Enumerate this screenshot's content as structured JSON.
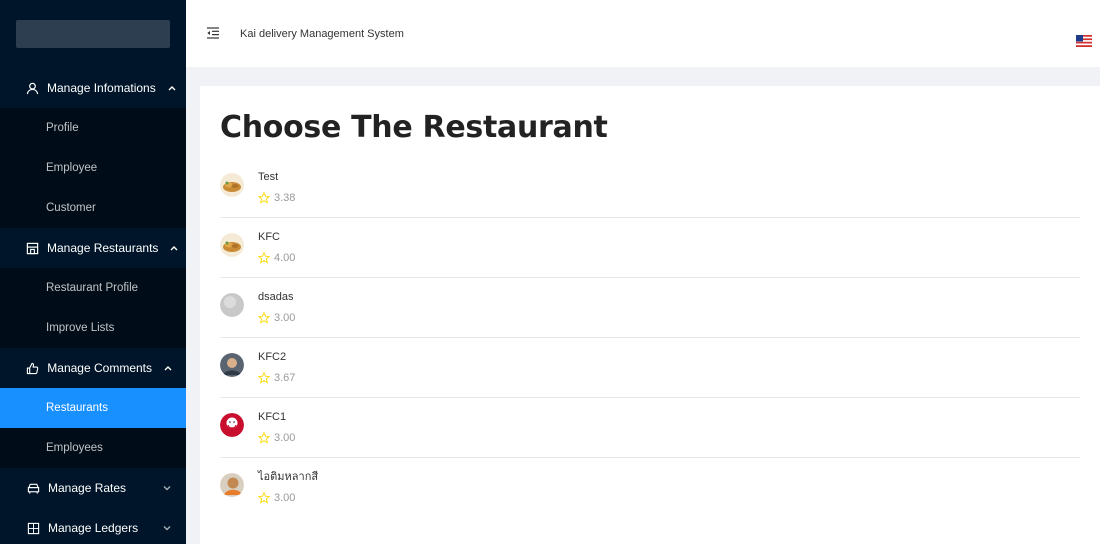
{
  "header": {
    "title": "Kai delivery Management System"
  },
  "sidebar": {
    "groups": [
      {
        "label": "Manage Infomations",
        "icon": "user-icon",
        "expanded": true,
        "items": [
          {
            "label": "Profile"
          },
          {
            "label": "Employee"
          },
          {
            "label": "Customer"
          }
        ]
      },
      {
        "label": "Manage Restaurants",
        "icon": "shop-icon",
        "expanded": true,
        "items": [
          {
            "label": "Restaurant Profile"
          },
          {
            "label": "Improve Lists"
          }
        ]
      },
      {
        "label": "Manage Comments",
        "icon": "like-icon",
        "expanded": true,
        "items": [
          {
            "label": "Restaurants",
            "active": true
          },
          {
            "label": "Employees"
          }
        ]
      },
      {
        "label": "Manage Rates",
        "icon": "car-icon",
        "expanded": false,
        "items": []
      },
      {
        "label": "Manage Ledgers",
        "icon": "calculator-icon",
        "expanded": false,
        "items": []
      }
    ]
  },
  "main": {
    "title": "Choose The Restaurant",
    "restaurants": [
      {
        "name": "Test",
        "rating": "3.38",
        "avatar": "food-avatar"
      },
      {
        "name": "KFC",
        "rating": "4.00",
        "avatar": "food-avatar"
      },
      {
        "name": "dsadas",
        "rating": "3.00",
        "avatar": "blank-avatar"
      },
      {
        "name": "KFC2",
        "rating": "3.67",
        "avatar": "person-avatar"
      },
      {
        "name": "KFC1",
        "rating": "3.00",
        "avatar": "kfc-logo-avatar"
      },
      {
        "name": "ไอติมหลากสี",
        "rating": "3.00",
        "avatar": "person-avatar"
      }
    ]
  },
  "colors": {
    "sidebar_bg": "#001529",
    "submenu_bg": "#000c17",
    "active": "#1890ff",
    "star": "#fadb14"
  }
}
